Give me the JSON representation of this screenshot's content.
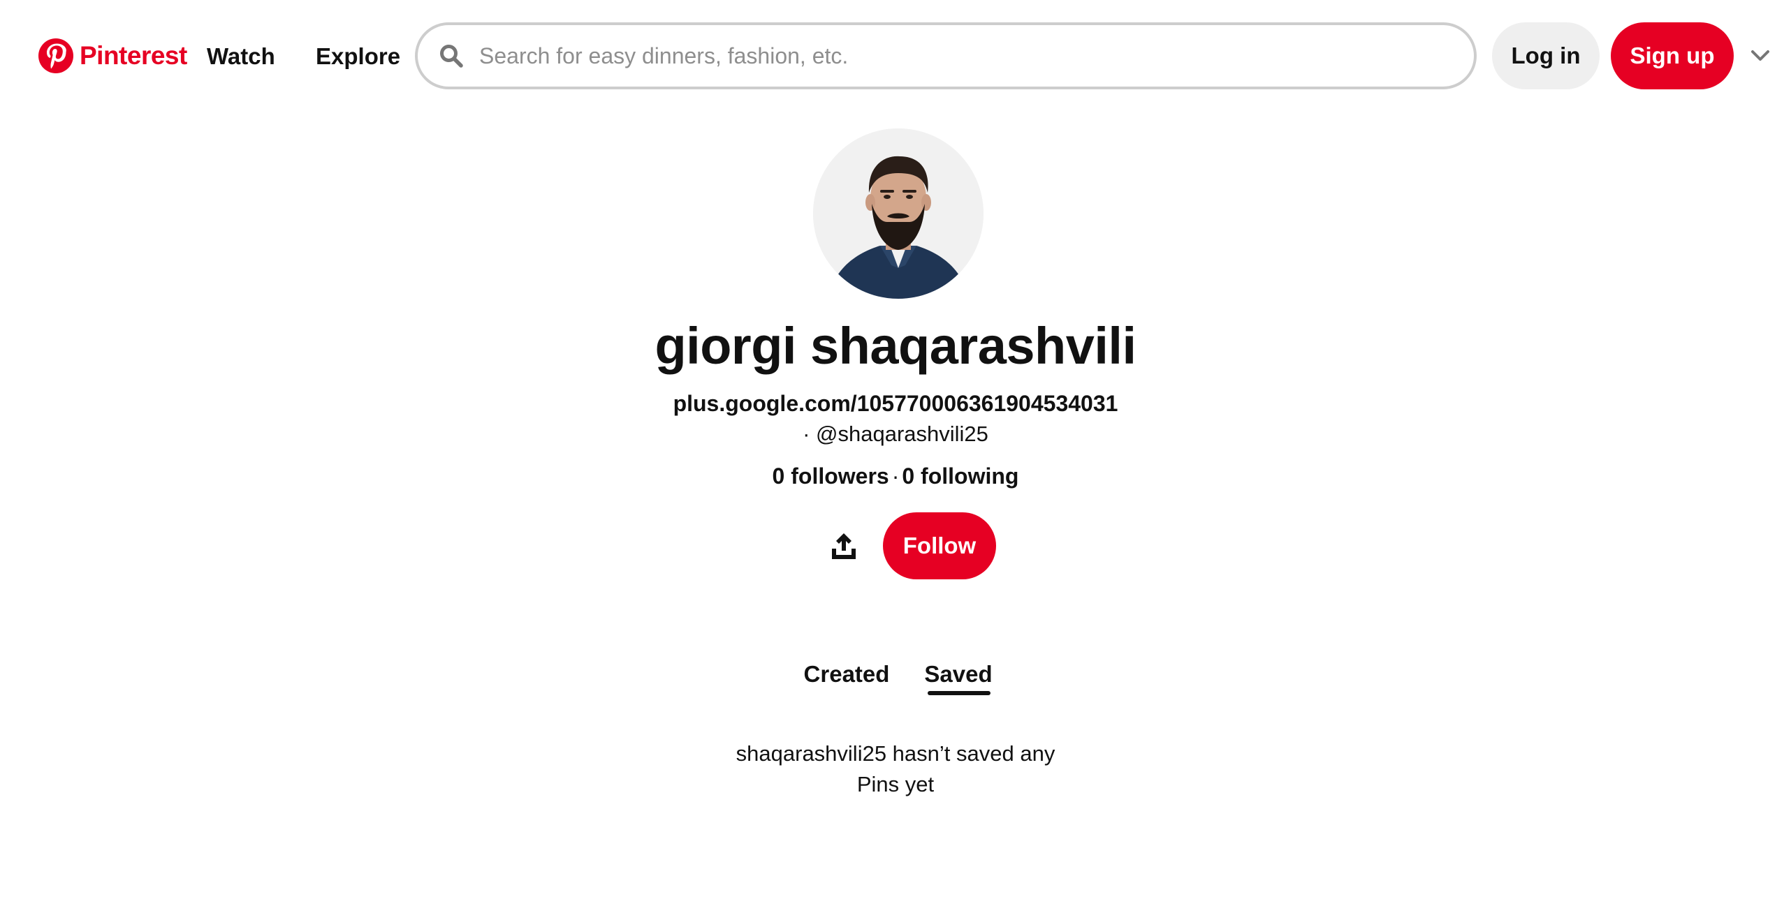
{
  "header": {
    "brand": "Pinterest",
    "nav": {
      "watch": "Watch",
      "explore": "Explore"
    },
    "search": {
      "placeholder": "Search for easy dinners, fashion, etc.",
      "value": ""
    },
    "login_label": "Log in",
    "signup_label": "Sign up",
    "icons": {
      "logo": "pinterest-logo-icon",
      "search": "search-icon",
      "more": "chevron-down-icon"
    }
  },
  "profile": {
    "name": "giorgi shaqarashvili",
    "website": "plus.google.com/105770006361904534031",
    "handle": "· @shaqarashvili25",
    "followers": "0 followers",
    "separator": "·",
    "following": "0 following",
    "follow_label": "Follow",
    "share_icon": "share-icon",
    "avatar": "profile-photo"
  },
  "tabs": {
    "created": "Created",
    "saved": "Saved",
    "active": "Saved"
  },
  "empty_state": {
    "line1": "shaqarashvili25 hasn’t saved any",
    "line2": "Pins yet"
  },
  "colors": {
    "brand_red": "#e60023",
    "text": "#111111",
    "login_bg": "#efefef",
    "search_border": "#cdcdcd",
    "placeholder": "#8e8e8e"
  }
}
